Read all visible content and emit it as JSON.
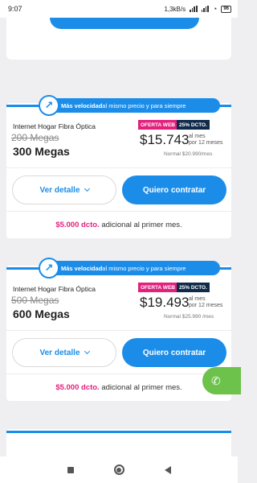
{
  "status_bar": {
    "time": "9:07",
    "network_speed": "1,3kB/s",
    "battery": "96",
    "icons": [
      "signal-icon",
      "wifi-icon",
      "battery-icon"
    ]
  },
  "colors": {
    "accent": "#1b8de9",
    "offer_pink": "#e2207d",
    "dcto_navy": "#0f2b4a",
    "chat_green": "#6cc24a"
  },
  "plans": [
    {
      "banner_bold": "Más velocidad",
      "banner_rest": " al mismo precio y para siempre",
      "name": "Internet Hogar Fibra Óptica",
      "old_speed": "200 Megas",
      "new_speed": "300 Megas",
      "offer_tag": "OFERTA WEB",
      "discount_tag": "25% DCTO.",
      "price": "$15.743",
      "price_per_1": "al mes",
      "price_per_2": "por 12 meses",
      "normal_price": "Normal $20.990/mes",
      "detail_label": "Ver detalle",
      "buy_label": "Quiero contratar",
      "extra_discount": "$5.000 dcto.",
      "extra_text": " adicional al primer mes."
    },
    {
      "banner_bold": "Más velocidad",
      "banner_rest": " al mismo precio y para siempre",
      "name": "Internet Hogar Fibra Óptica",
      "old_speed": "500 Megas",
      "new_speed": "600 Megas",
      "offer_tag": "OFERTA WEB",
      "discount_tag": "25% DCTO.",
      "price": "$19.493",
      "price_per_1": "al mes",
      "price_per_2": "por 12 meses",
      "normal_price": "Normal $25.990 /mes",
      "detail_label": "Ver detalle",
      "buy_label": "Quiero contratar",
      "extra_discount": "$5.000 dcto.",
      "extra_text": " adicional al primer mes."
    }
  ],
  "chat_fab": {
    "icon": "chat-phone-icon"
  },
  "nav_bar": {
    "icons": [
      "recents-icon",
      "home-icon",
      "back-icon"
    ]
  }
}
